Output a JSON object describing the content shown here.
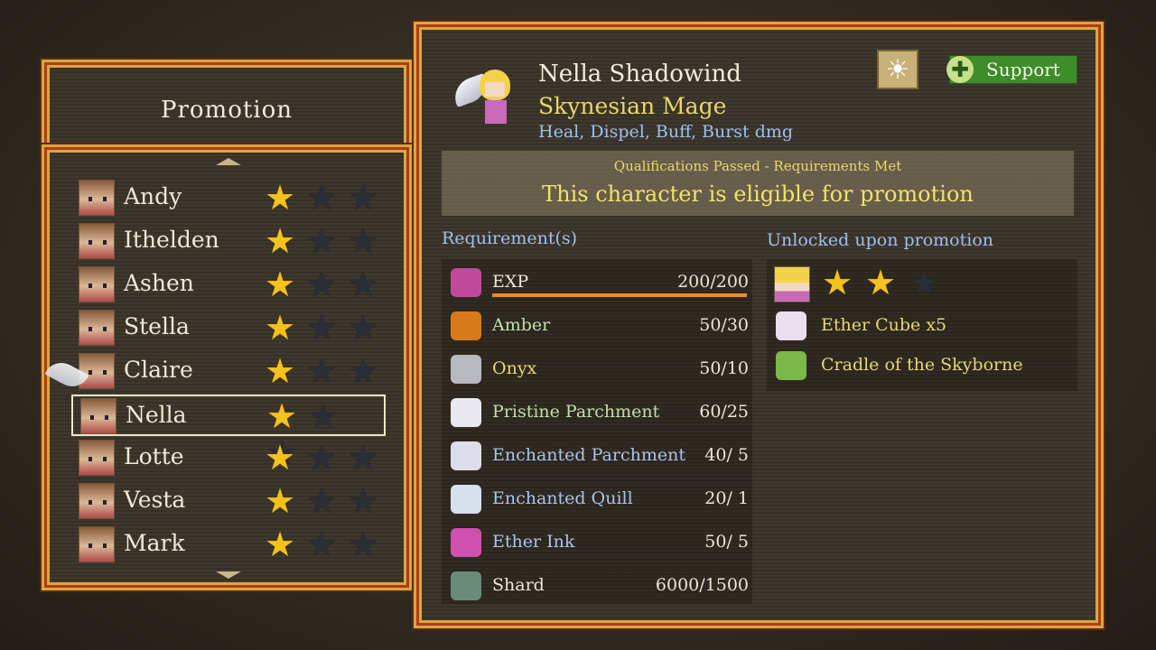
{
  "promotion_panel": {
    "title": "Promotion",
    "roster": [
      {
        "name": "Andy",
        "stars": [
          "filled",
          "empty",
          "empty"
        ]
      },
      {
        "name": "Ithelden",
        "stars": [
          "filled",
          "empty",
          "empty"
        ]
      },
      {
        "name": "Ashen",
        "stars": [
          "filled",
          "empty",
          "empty"
        ]
      },
      {
        "name": "Stella",
        "stars": [
          "filled",
          "empty",
          "empty"
        ]
      },
      {
        "name": "Claire",
        "stars": [
          "filled",
          "empty",
          "empty"
        ]
      },
      {
        "name": "Nella",
        "stars": [
          "filled",
          "empty",
          "empty"
        ],
        "selected": true
      },
      {
        "name": "Lotte",
        "stars": [
          "filled",
          "empty",
          "empty"
        ]
      },
      {
        "name": "Vesta",
        "stars": [
          "filled",
          "empty",
          "empty"
        ]
      },
      {
        "name": "Mark",
        "stars": [
          "filled",
          "empty",
          "empty"
        ]
      }
    ]
  },
  "character": {
    "name": "Nella Shadowind",
    "class": "Skynesian Mage",
    "roles": "Heal, Dispel, Buff, Burst dmg",
    "element_icon": "sun-icon",
    "role_badge": "Support"
  },
  "status": {
    "small": "Qualifications Passed - Requirements Met",
    "big": "This character is eligible for promotion"
  },
  "requirements": {
    "header": "Requirement(s)",
    "items": [
      {
        "name": "EXP",
        "value": "200/200",
        "icon": "exp-book-icon",
        "color": "#ece6d4",
        "progress": 1.0
      },
      {
        "name": "Amber",
        "value": "50/30",
        "icon": "amber-gem-icon",
        "color": "#bfe0a8"
      },
      {
        "name": "Onyx",
        "value": "50/10",
        "icon": "onyx-stone-icon",
        "color": "#e8d86a"
      },
      {
        "name": "Pristine Parchment",
        "value": "60/25",
        "icon": "parchment-icon",
        "color": "#bfe0a8"
      },
      {
        "name": "Enchanted Parchment",
        "value": "40/ 5",
        "icon": "enchanted-parchment-icon",
        "color": "#a8c4ea"
      },
      {
        "name": "Enchanted Quill",
        "value": "20/ 1",
        "icon": "quill-icon",
        "color": "#a8c4ea"
      },
      {
        "name": "Ether Ink",
        "value": "50/ 5",
        "icon": "ink-bottle-icon",
        "color": "#a8c4ea"
      },
      {
        "name": "Shard",
        "value": "6000/1500",
        "icon": "shard-icon",
        "color": "#ece6d4"
      }
    ]
  },
  "unlocks": {
    "header": "Unlocked upon promotion",
    "stars": [
      "filled",
      "filled",
      "empty"
    ],
    "items": [
      {
        "name": "Ether Cube x5",
        "icon": "gift-box-icon"
      },
      {
        "name": "Cradle of the Skyborne",
        "icon": "tome-icon"
      }
    ]
  },
  "colors": {
    "frame_gold": "#d9a93c",
    "frame_red": "#b03a20",
    "panel_bg": "#3b342a",
    "star_filled": "#f4c21c",
    "star_empty": "#2a2e36",
    "support_green": "#3f8c2a"
  }
}
